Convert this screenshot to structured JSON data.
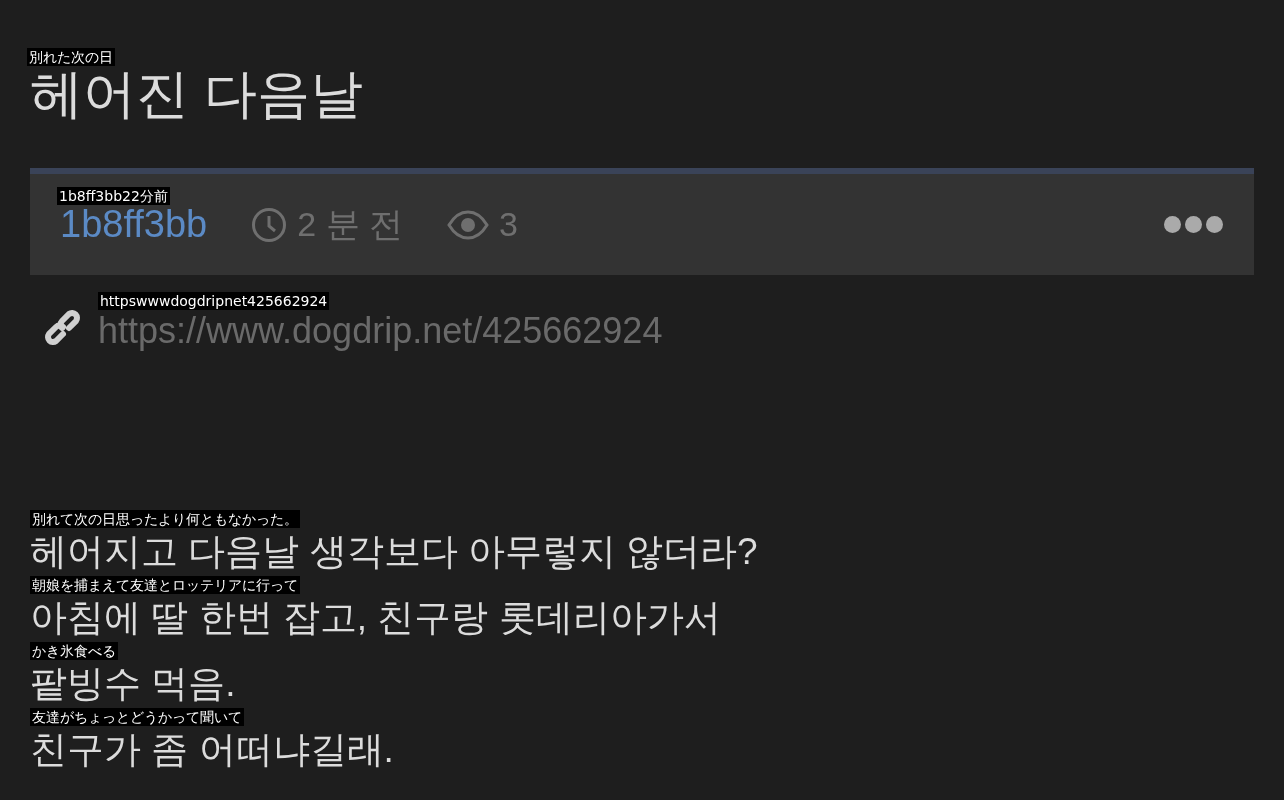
{
  "title": {
    "text": "헤어진 다음날",
    "overlay": "別れた次の日"
  },
  "meta": {
    "author": "1b8ff3bb",
    "time": "2 분 전",
    "views": "3",
    "overlay": "1b8ff3bb22分前"
  },
  "link": {
    "url": "https://www.dogdrip.net/425662924",
    "overlay": "httpswwwdogdripnet425662924"
  },
  "body": [
    {
      "text": "헤어지고 다음날 생각보다 아무렇지 않더라?",
      "overlay": "別れて次の日思ったより何ともなかった。"
    },
    {
      "text": "아침에 딸 한번 잡고, 친구랑 롯데리아가서",
      "overlay": "朝娘を捕まえて友達とロッテリアに行って"
    },
    {
      "text": "팥빙수 먹음.",
      "overlay": "かき氷食べる"
    },
    {
      "text": "친구가 좀 어떠냐길래.",
      "overlay": "友達がちょっとどうかって聞いて"
    }
  ]
}
